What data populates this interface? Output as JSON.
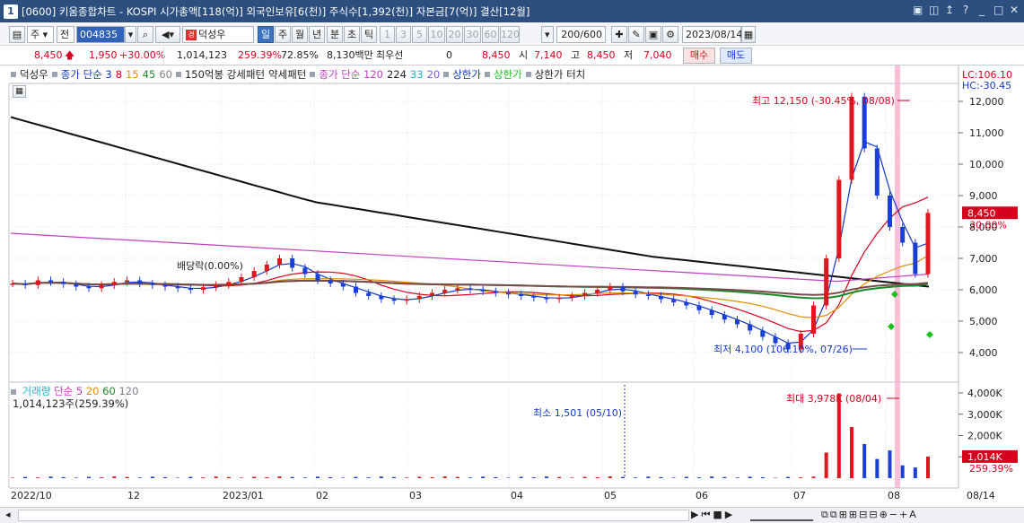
{
  "window": {
    "app_number": "1",
    "title": "[0600] 키움종합차트 - KOSPI 시가총액[118(억)] 외국인보유[6(천)] 주식수[1,392(천)] 자본금[7(억)] 결산[12월]",
    "buttons": [
      "▣",
      "◫",
      "↥",
      "?",
      "_",
      "□",
      "✕"
    ]
  },
  "toolbar": {
    "market_type": "주",
    "market_scope": "전",
    "stock_code": "004835",
    "stock_name": "덕성우",
    "period_buttons": [
      "일",
      "주",
      "월",
      "년",
      "분",
      "초",
      "틱"
    ],
    "period_selected": "일",
    "interval_buttons": [
      "1",
      "3",
      "5",
      "10",
      "20",
      "30",
      "60",
      "120"
    ],
    "data_count": "200/600",
    "date": "2023/08/14"
  },
  "price_row": {
    "current": "8,450",
    "change": "1,950",
    "change_rate": "+30.00%",
    "volume": "1,014,123",
    "volume_rate": "259.39%",
    "ratio": "72.85%",
    "amount": "8,130백만",
    "label_choewoo": "최우선",
    "choewoo_value": "0",
    "price2": "8,450",
    "open_label": "시",
    "open": "7,140",
    "high_label": "고",
    "high": "8,450",
    "low_label": "저",
    "low": "7,040",
    "buy_label": "매수",
    "sell_label": "매도"
  },
  "legend": {
    "stock": "덕성우",
    "ma_label": "종가 단순 3",
    "ma_periods": [
      "8",
      "15",
      "45",
      "60"
    ],
    "item_150": "150억봉 강세패턴",
    "item_weak": "약세패턴",
    "ma120": "종가 단순 120",
    "num224": "224",
    "num33": "33",
    "num20": "20",
    "upper_limit": "상한가",
    "upper_limit2": "상한가",
    "upper_touch": "상한가 터치"
  },
  "colors": {
    "title_bg": "#2d4f80",
    "candle_up": "#e0161e",
    "candle_down": "#1a3fd6",
    "ma120": "#c43bc4",
    "ma224": "#111111",
    "highlight": "#f9b4d2"
  },
  "chart_data": {
    "type": "candlestick",
    "price_axis_ticks": [
      "12,000",
      "11,000",
      "10,000",
      "9,000",
      "8,000",
      "7,000",
      "6,000",
      "5,000",
      "4,000"
    ],
    "current_price_tag": "8,450",
    "current_rate_tag": "30.00%",
    "lc_label": "LC:106.10",
    "hc_label": "HC:-30.45",
    "annotation_high": "최고 12,150 (-30.45%, 08/08)",
    "annotation_low": "최저 4,100 (106.10%, 07/26)",
    "dividend_label": "배당락(0.00%)",
    "x_ticks": [
      "2022/10",
      "12",
      "2023/01",
      "02",
      "03",
      "04",
      "05",
      "06",
      "07",
      "08",
      "08/14"
    ],
    "price_series_close": [
      6200,
      6150,
      6300,
      6250,
      6180,
      6100,
      6050,
      6150,
      6250,
      6300,
      6200,
      6150,
      6100,
      6050,
      6000,
      6080,
      6150,
      6250,
      6400,
      6600,
      6800,
      7000,
      6700,
      6500,
      6300,
      6200,
      6100,
      5900,
      5800,
      5700,
      5650,
      5700,
      5800,
      5900,
      6000,
      6050,
      6000,
      5950,
      5900,
      5850,
      5800,
      5750,
      5700,
      5750,
      5800,
      5900,
      6000,
      6100,
      5950,
      5850,
      5800,
      5700,
      5600,
      5500,
      5350,
      5200,
      5050,
      4900,
      4700,
      4500,
      4300,
      4100,
      4600,
      5500,
      7000,
      9500,
      12150,
      10500,
      9000,
      8000,
      7500,
      6500,
      8450
    ],
    "ma224_ticks_start": 11500,
    "volume_label": "거래량",
    "volume_ma": "단순 5",
    "volume_ma_periods": [
      "20",
      "60",
      "120"
    ],
    "volume_value": "1,014,123주(259.39%)",
    "annotation_vol_max": "최대 3,978K (08/04)",
    "annotation_vol_min": "최소 1,501 (05/10)",
    "volume_axis_ticks": [
      "4,000K",
      "3,000K",
      "2,000K",
      "1,000K"
    ],
    "volume_tag": "1,014K",
    "volume_rate_tag": "259.39%"
  }
}
